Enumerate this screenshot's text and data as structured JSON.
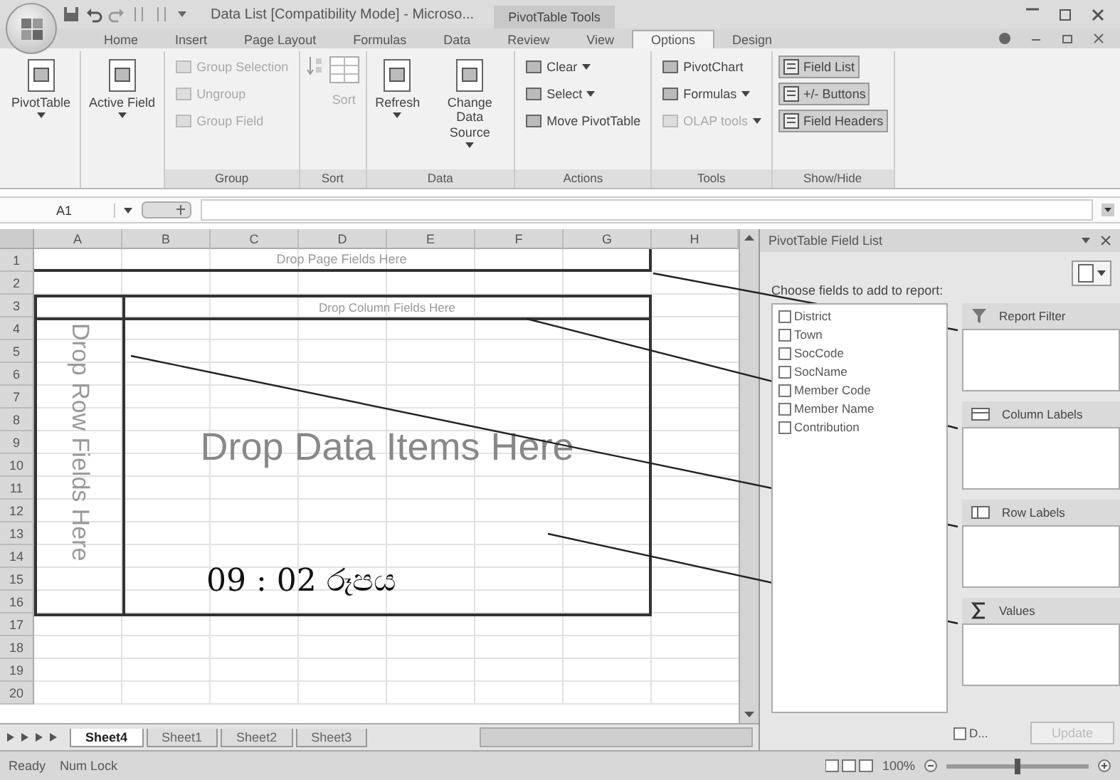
{
  "window": {
    "title": "Data List [Compatibility Mode] - Microso...",
    "context_tab": "PivotTable Tools"
  },
  "ribbon_tabs": [
    {
      "label": "Home",
      "selected": false
    },
    {
      "label": "Insert",
      "selected": false
    },
    {
      "label": "Page Layout",
      "selected": false
    },
    {
      "label": "Formulas",
      "selected": false
    },
    {
      "label": "Data",
      "selected": false
    },
    {
      "label": "Review",
      "selected": false
    },
    {
      "label": "View",
      "selected": false
    },
    {
      "label": "Options",
      "selected": true
    },
    {
      "label": "Design",
      "selected": false
    }
  ],
  "ribbon_groups": [
    {
      "items": [
        {
          "kind": "large",
          "label": "PivotTable",
          "menu": true,
          "disabled": false
        }
      ]
    },
    {
      "items": [
        {
          "kind": "large",
          "label": "Active Field",
          "menu": true,
          "disabled": false
        }
      ]
    },
    {
      "label": "Group",
      "items": [
        {
          "kind": "small",
          "label": "Group Selection",
          "menu": false,
          "disabled": true
        },
        {
          "kind": "small",
          "label": "Ungroup",
          "menu": false,
          "disabled": true
        },
        {
          "kind": "small",
          "label": "Group Field",
          "menu": false,
          "disabled": true
        }
      ]
    },
    {
      "label": "Sort",
      "items": [
        {
          "kind": "sort",
          "label": "Sort",
          "disabled": true
        }
      ]
    },
    {
      "label": "Data",
      "items": [
        {
          "kind": "large",
          "label": "Refresh",
          "menu": true,
          "disabled": false
        },
        {
          "kind": "large",
          "label": "Change Data Source",
          "menu": true,
          "disabled": false
        }
      ]
    },
    {
      "label": "Actions",
      "items": [
        {
          "kind": "small",
          "label": "Clear",
          "menu": true,
          "disabled": false
        },
        {
          "kind": "small",
          "label": "Select",
          "menu": true,
          "disabled": false
        },
        {
          "kind": "small",
          "label": "Move PivotTable",
          "menu": false,
          "disabled": false
        }
      ]
    },
    {
      "label": "Tools",
      "items": [
        {
          "kind": "small",
          "label": "PivotChart",
          "menu": false,
          "disabled": false
        },
        {
          "kind": "small",
          "label": "Formulas",
          "menu": true,
          "disabled": false
        },
        {
          "kind": "small",
          "label": "OLAP tools",
          "menu": true,
          "disabled": true
        }
      ]
    },
    {
      "label": "Show/Hide",
      "items": [
        {
          "kind": "toggle",
          "label": "Field List",
          "on": true
        },
        {
          "kind": "toggle",
          "label": "+/- Buttons",
          "on": true
        },
        {
          "kind": "toggle",
          "label": "Field Headers",
          "on": true
        }
      ]
    }
  ],
  "formula_bar": {
    "name_box": "A1"
  },
  "sheet": {
    "columns": [
      "A",
      "B",
      "C",
      "D",
      "E",
      "F",
      "G",
      "H"
    ],
    "rows": [
      "1",
      "2",
      "3",
      "4",
      "5",
      "6",
      "7",
      "8",
      "9",
      "10",
      "11",
      "12",
      "13",
      "14",
      "15",
      "16",
      "17",
      "18",
      "19",
      "20"
    ],
    "page_zone": "Drop Page Fields Here",
    "column_zone": "Drop Column Fields Here",
    "row_zone": "Drop Row Fields Here",
    "data_zone": "Drop Data Items Here"
  },
  "sheet_tabs": [
    {
      "label": "Sheet4",
      "selected": true
    },
    {
      "label": "Sheet1",
      "selected": false
    },
    {
      "label": "Sheet2",
      "selected": false
    },
    {
      "label": "Sheet3",
      "selected": false
    }
  ],
  "field_list": {
    "title": "PivotTable Field List",
    "prompt": "Choose fields to add to report:",
    "fields": [
      {
        "label": "District",
        "checked": false
      },
      {
        "label": "Town",
        "checked": false
      },
      {
        "label": "SocCode",
        "checked": false
      },
      {
        "label": "SocName",
        "checked": false
      },
      {
        "label": "Member Code",
        "checked": false
      },
      {
        "label": "Member Name",
        "checked": false
      },
      {
        "label": "Contribution",
        "checked": false
      }
    ],
    "areas": [
      {
        "kind": "filter",
        "label": "Report Filter"
      },
      {
        "kind": "columns",
        "label": "Column Labels"
      },
      {
        "kind": "rows",
        "label": "Row Labels"
      },
      {
        "kind": "values",
        "label": "Values"
      }
    ],
    "defer": {
      "label": "D...",
      "checked": false
    },
    "update_button": {
      "label": "Update",
      "disabled": true
    }
  },
  "status_bar": {
    "items": [
      "Ready",
      "Num Lock"
    ],
    "zoom": "100%",
    "level": 0.5
  },
  "caption": "09 : 02 රූපය"
}
